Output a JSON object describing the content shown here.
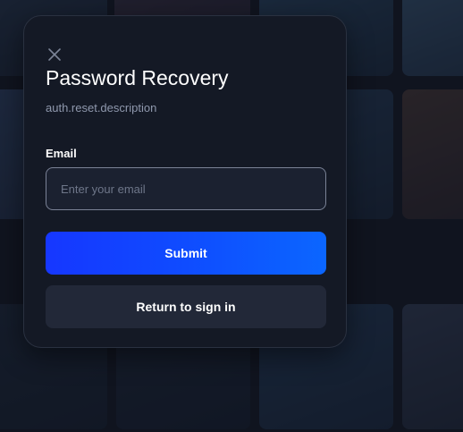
{
  "modal": {
    "close_icon": "close-icon",
    "title": "Password Recovery",
    "subtitle": "auth.reset.description",
    "email": {
      "label": "Email",
      "placeholder": "Enter your email",
      "value": ""
    },
    "submit_label": "Submit",
    "return_label": "Return to sign in"
  },
  "colors": {
    "modal_background": "#141925",
    "primary_button": "#0f4cff",
    "secondary_button": "#222838",
    "input_border": "#7a8296",
    "subtitle_text": "#8f98ad"
  }
}
